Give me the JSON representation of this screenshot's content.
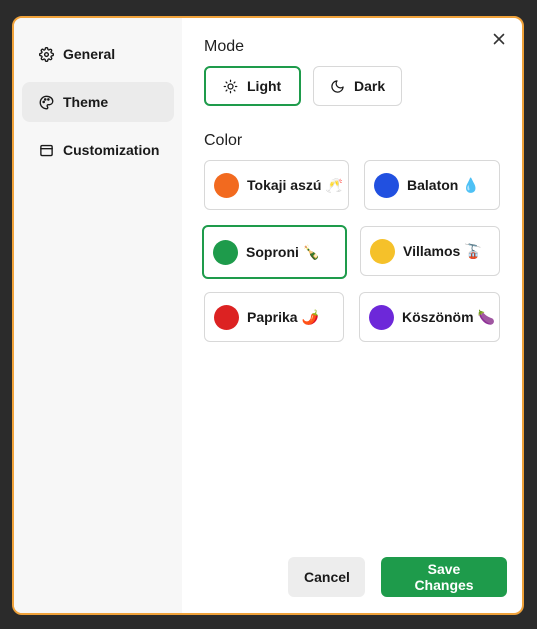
{
  "sidebar": {
    "items": [
      {
        "label": "General",
        "icon": "gear-icon"
      },
      {
        "label": "Theme",
        "icon": "palette-icon",
        "active": true
      },
      {
        "label": "Customization",
        "icon": "window-icon"
      }
    ]
  },
  "mode": {
    "title": "Mode",
    "options": [
      {
        "label": "Light",
        "icon": "sun-icon",
        "selected": true
      },
      {
        "label": "Dark",
        "icon": "moon-icon",
        "selected": false
      }
    ]
  },
  "color": {
    "title": "Color",
    "options": [
      {
        "label": "Tokaji aszú",
        "emoji": "🥂",
        "swatch": "#f26a1f"
      },
      {
        "label": "Balaton",
        "emoji": "💧",
        "swatch": "#2150e0"
      },
      {
        "label": "Soproni",
        "emoji": "🍾",
        "swatch": "#1e9b4b",
        "selected": true
      },
      {
        "label": "Villamos",
        "emoji": "🚡",
        "swatch": "#f5c12a"
      },
      {
        "label": "Paprika",
        "emoji": "🌶️",
        "swatch": "#dc2222"
      },
      {
        "label": "Köszönöm",
        "emoji": "🍆",
        "swatch": "#6d28d9"
      }
    ]
  },
  "footer": {
    "cancel_label": "Cancel",
    "save_label": "Save Changes"
  },
  "colors": {
    "accent": "#1e9b4b",
    "dialog_border": "#f0a23a"
  }
}
